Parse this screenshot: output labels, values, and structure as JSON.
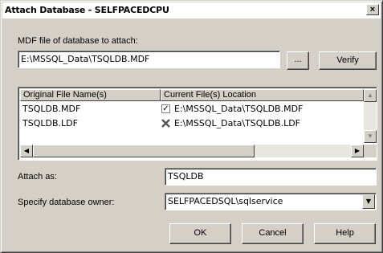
{
  "window": {
    "title": "Attach Database - SELFPACEDCPU",
    "close_glyph": "×"
  },
  "mdf": {
    "label": "MDF file of database to attach:",
    "value": "E:\\MSSQL_Data\\TSQLDB.MDF",
    "browse_label": "...",
    "verify_label": "Verify"
  },
  "files": {
    "columns": [
      "Original File Name(s)",
      "Current File(s) Location"
    ],
    "rows": [
      {
        "original": "TSQLDB.MDF",
        "status": "check",
        "location": "E:\\MSSQL_Data\\TSQLDB.MDF"
      },
      {
        "original": "TSQLDB.LDF",
        "status": "x",
        "location": "E:\\MSSQL_Data\\TSQLDB.LDF"
      }
    ],
    "check_glyph": "✓"
  },
  "attach_as": {
    "label": "Attach as:",
    "value": "TSQLDB"
  },
  "owner": {
    "label": "Specify database owner:",
    "selected": "SELFPACEDSQL\\sqlservice"
  },
  "buttons": {
    "ok": "OK",
    "cancel": "Cancel",
    "help": "Help"
  },
  "scroll_glyphs": {
    "up": "▲",
    "down": "▼",
    "left": "◀",
    "right": "▶",
    "combo": "▼"
  }
}
